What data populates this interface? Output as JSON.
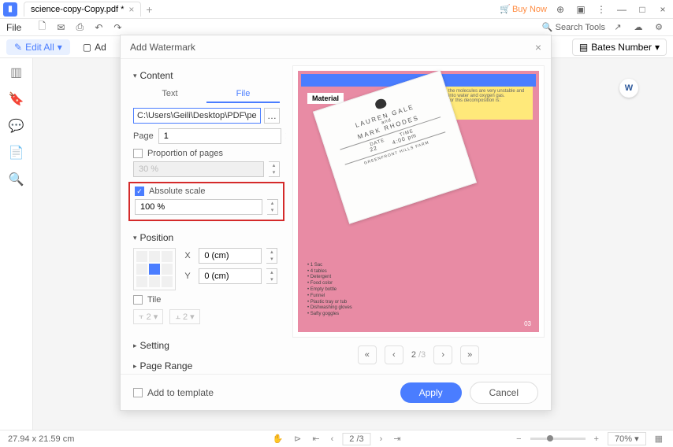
{
  "titlebar": {
    "tab_name": "science-copy-Copy.pdf *",
    "buy_now": "Buy Now"
  },
  "menubar": {
    "file": "File",
    "search_tools": "Search Tools"
  },
  "toolbar": {
    "edit_all": "Edit All",
    "add": "Ad",
    "bates": "Bates Number"
  },
  "modal": {
    "title": "Add Watermark",
    "content_section": "Content",
    "tabs": {
      "text": "Text",
      "file": "File"
    },
    "file_path": "C:\\Users\\Geili\\Desktop\\PDF\\perform o",
    "page_label": "Page",
    "page_value": "1",
    "proportion_label": "Proportion of pages",
    "proportion_value": "30 %",
    "absolute_label": "Absolute scale",
    "absolute_value": "100 %",
    "position_section": "Position",
    "x_label": "X",
    "y_label": "Y",
    "coord_value": "0 (cm)",
    "tile_label": "Tile",
    "tile_num": "2",
    "setting_section": "Setting",
    "page_range_section": "Page Range",
    "pager_current": "2",
    "pager_total": "/3",
    "add_template": "Add to template",
    "apply": "Apply",
    "cancel": "Cancel"
  },
  "preview": {
    "materials": "Material",
    "name1": "LAUREN GALE",
    "and": "and",
    "name2": "MARK RHODES",
    "date": "22",
    "time": "4:00 pm",
    "list": "• 1 Sac\n• 4 tables\n• Detergent\n• Food color\n• Empty bottle\n• Funnel\n• Plastic tray or tub\n• Dishwashing gloves\n• Safty goggles",
    "page_num": "03"
  },
  "statusbar": {
    "dimensions": "27.94 x 21.59 cm",
    "page": "2 /3",
    "zoom": "70%"
  }
}
